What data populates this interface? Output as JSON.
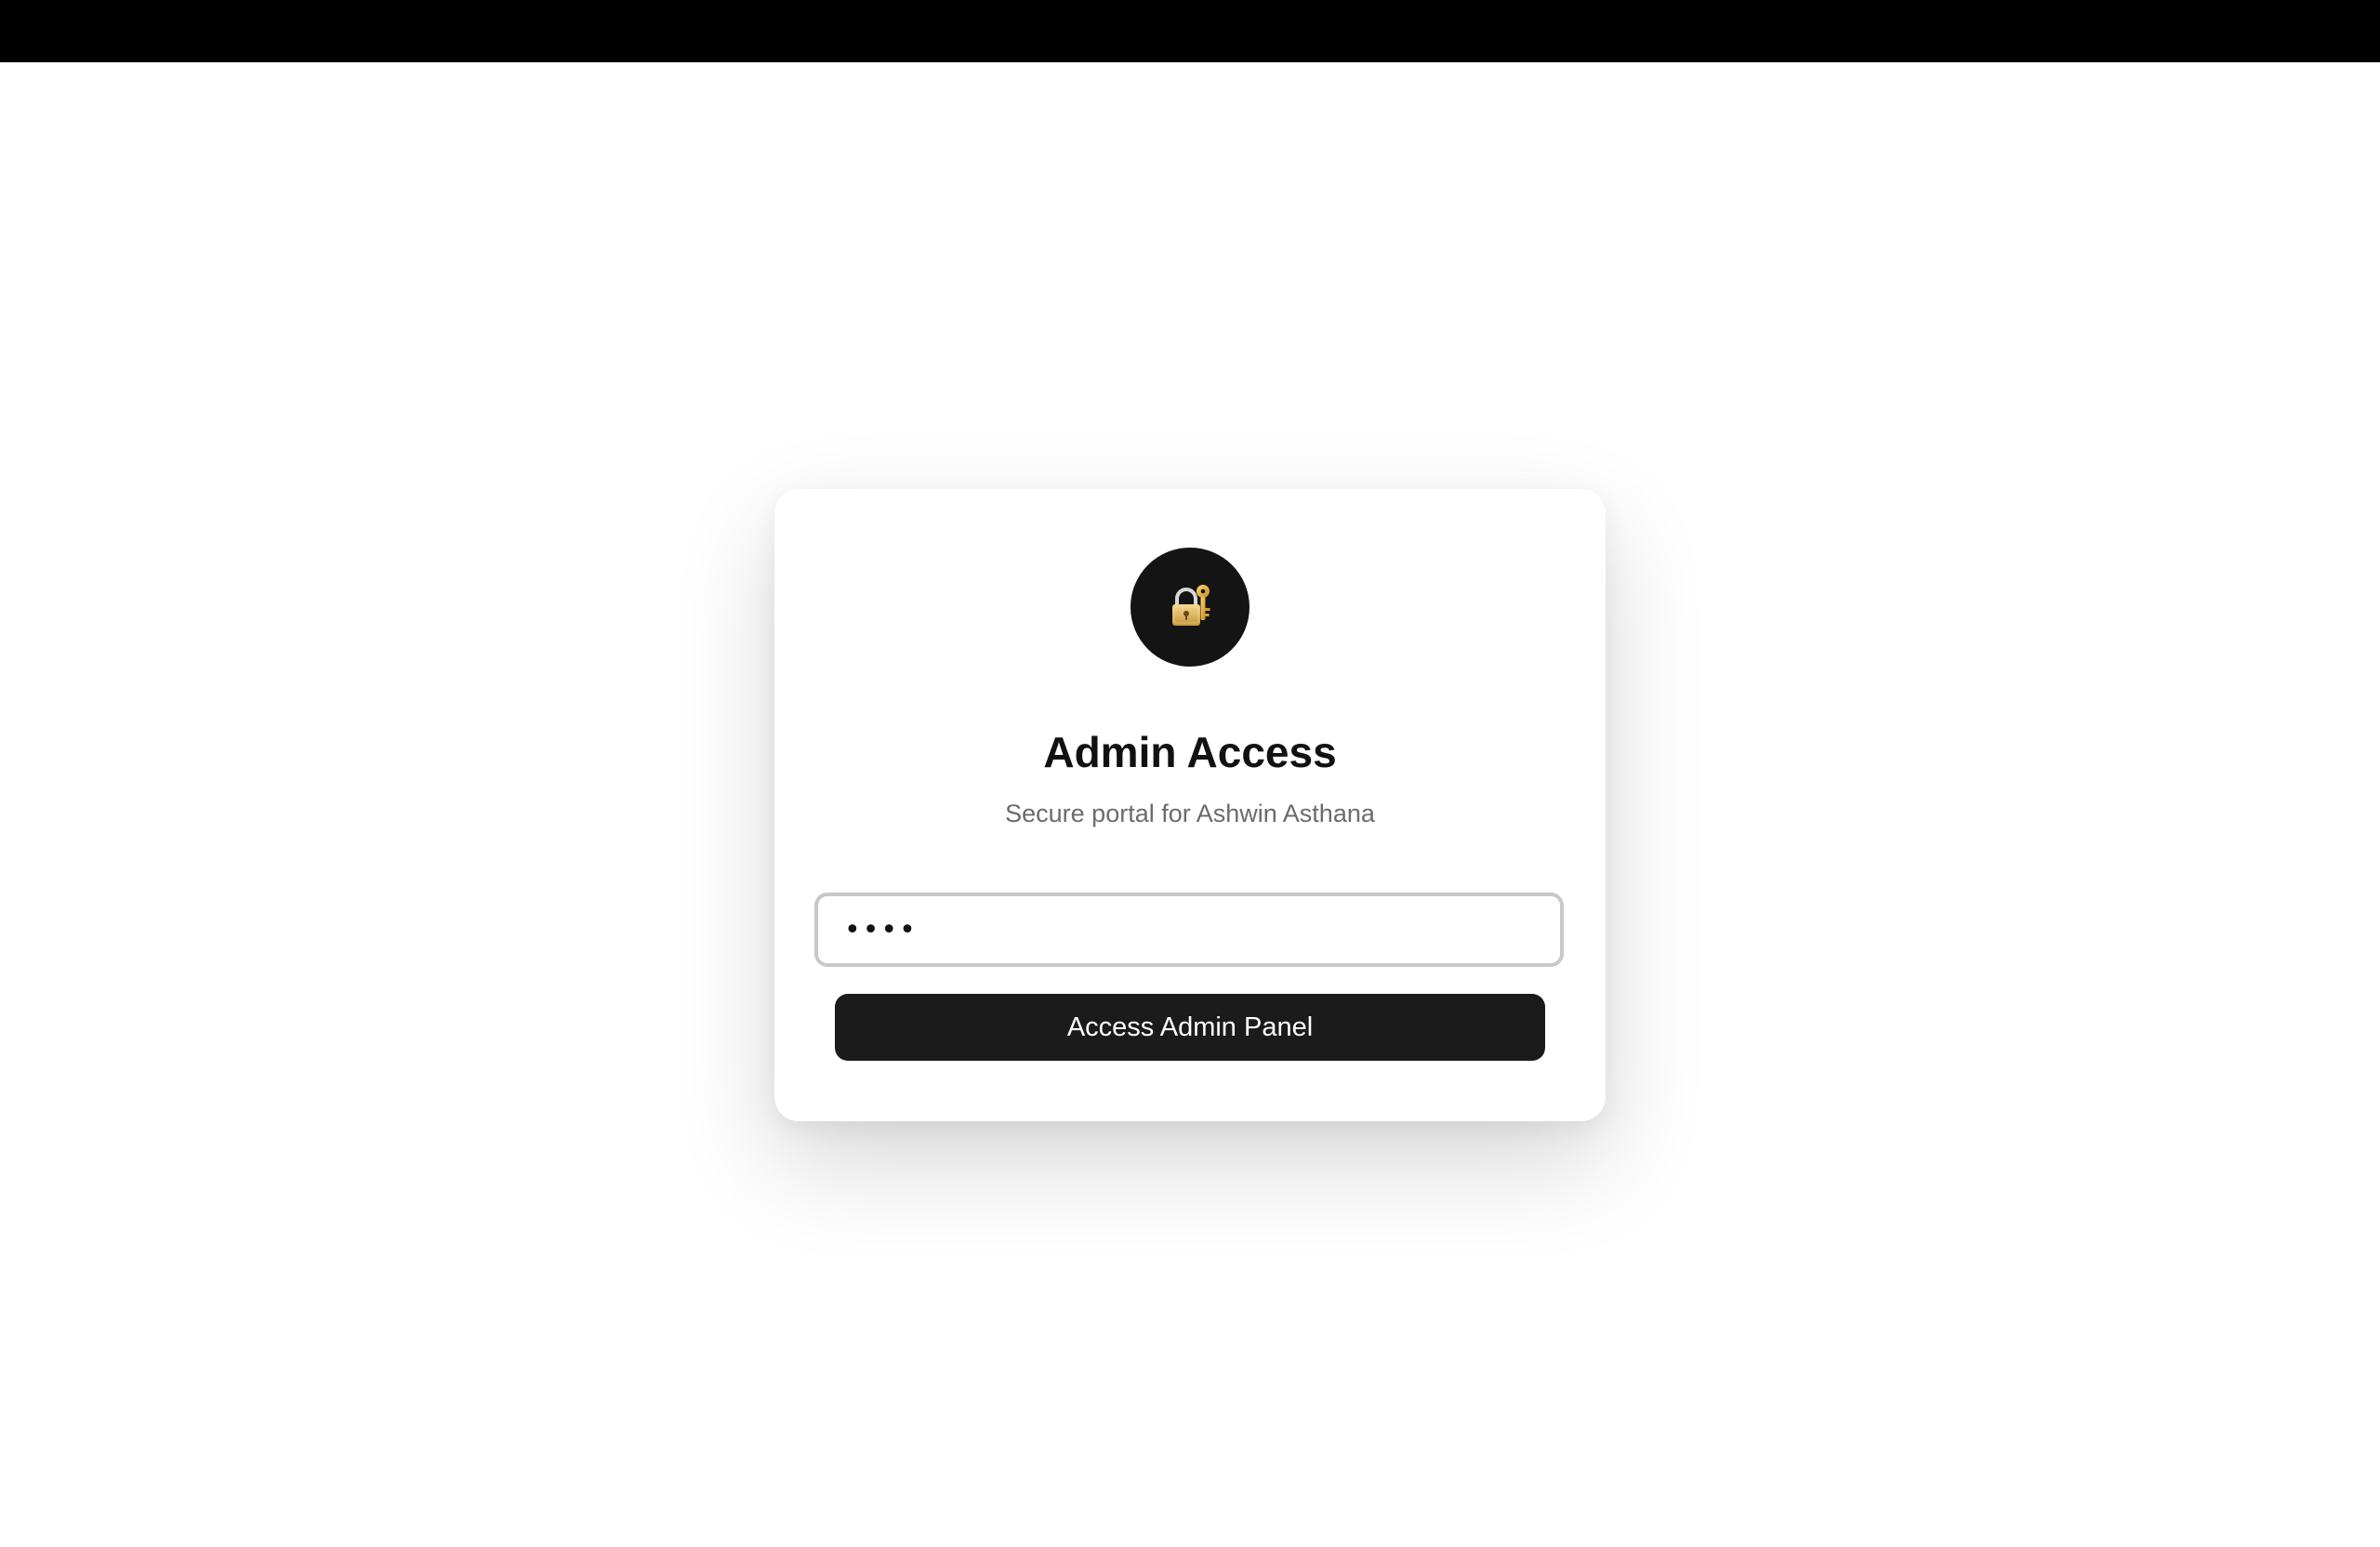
{
  "icon": {
    "name": "lock-key-icon",
    "background_color": "#141414",
    "accent_color": "#e2b85c"
  },
  "login": {
    "title": "Admin Access",
    "subtitle": "Secure portal for Ashwin Asthana",
    "password_value": "••••",
    "button_label": "Access Admin Panel"
  },
  "colors": {
    "top_bar": "#000000",
    "button": "#1b1b1b",
    "input_border": "#c8c8c8"
  }
}
